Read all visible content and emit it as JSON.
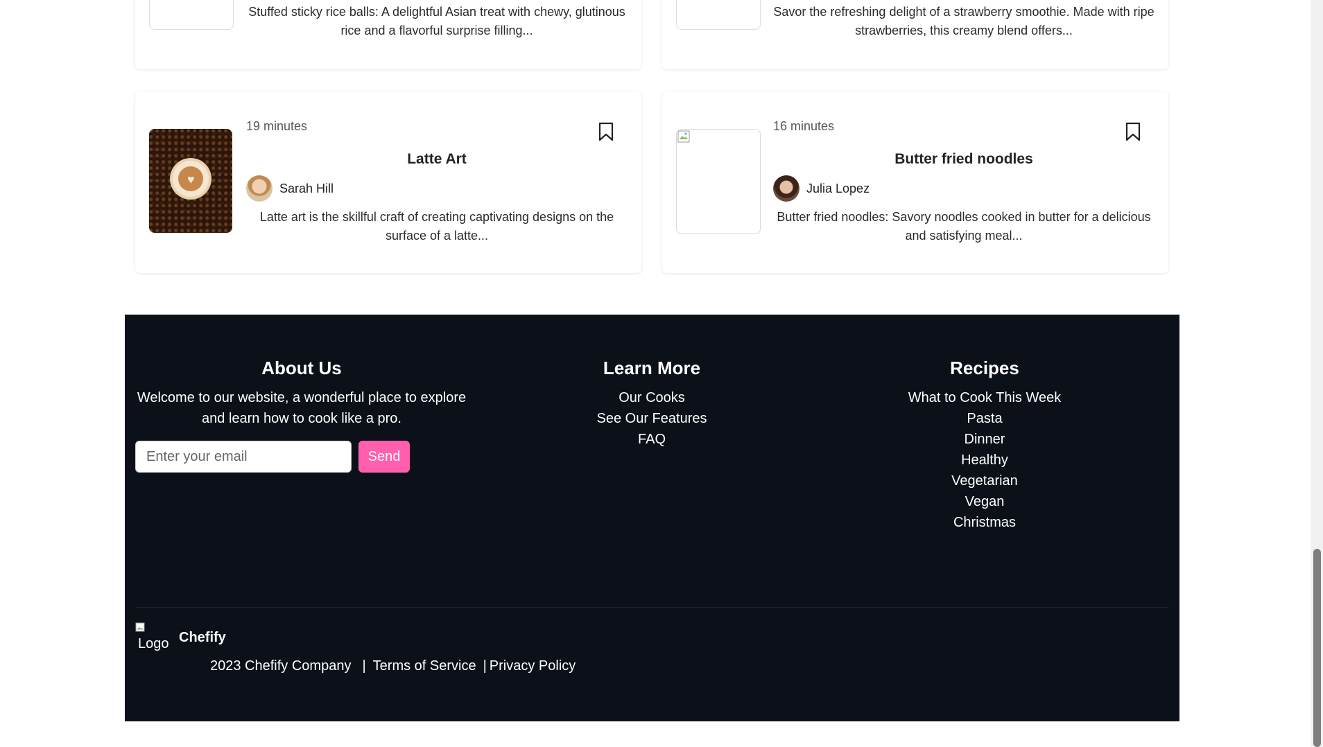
{
  "cards_top": [
    {
      "description": "Stuffed sticky rice balls: A delightful Asian treat with chewy, glutinous rice and a flavorful surprise filling..."
    },
    {
      "description": "Savor the refreshing delight of a strawberry smoothie. Made with ripe strawberries, this creamy blend offers..."
    }
  ],
  "cards": [
    {
      "minutes": "19 minutes",
      "title": "Latte Art",
      "author": "Sarah Hill",
      "description": "Latte art is the skillful craft of creating captivating designs on the surface of a latte...",
      "icon": "bookmark-icon"
    },
    {
      "minutes": "16 minutes",
      "title": "Butter fried noodles",
      "author": "Julia Lopez",
      "description": "Butter fried noodles: Savory noodles cooked in butter for a delicious and satisfying meal...",
      "icon": "bookmark-icon"
    }
  ],
  "footer": {
    "about": {
      "heading": "About Us",
      "text": "Welcome to our website, a wonderful place to explore and learn how to cook like a pro.",
      "email_placeholder": "Enter your email",
      "send_label": "Send"
    },
    "learn": {
      "heading": "Learn More",
      "links": [
        "Our Cooks",
        "See Our Features",
        "FAQ"
      ]
    },
    "recipes": {
      "heading": "Recipes",
      "links": [
        "What to Cook This Week",
        "Pasta",
        "Dinner",
        "Healthy",
        "Vegetarian",
        "Vegan",
        "Christmas"
      ]
    },
    "logo_alt": "Logo",
    "brand": "Chefify",
    "copyright": "2023 Chefify Company",
    "terms": "Terms of Service",
    "privacy": "Privacy Policy",
    "separator": "|"
  },
  "colors": {
    "footer_bg": "#0c1019",
    "send_button": "#ff5fae"
  }
}
